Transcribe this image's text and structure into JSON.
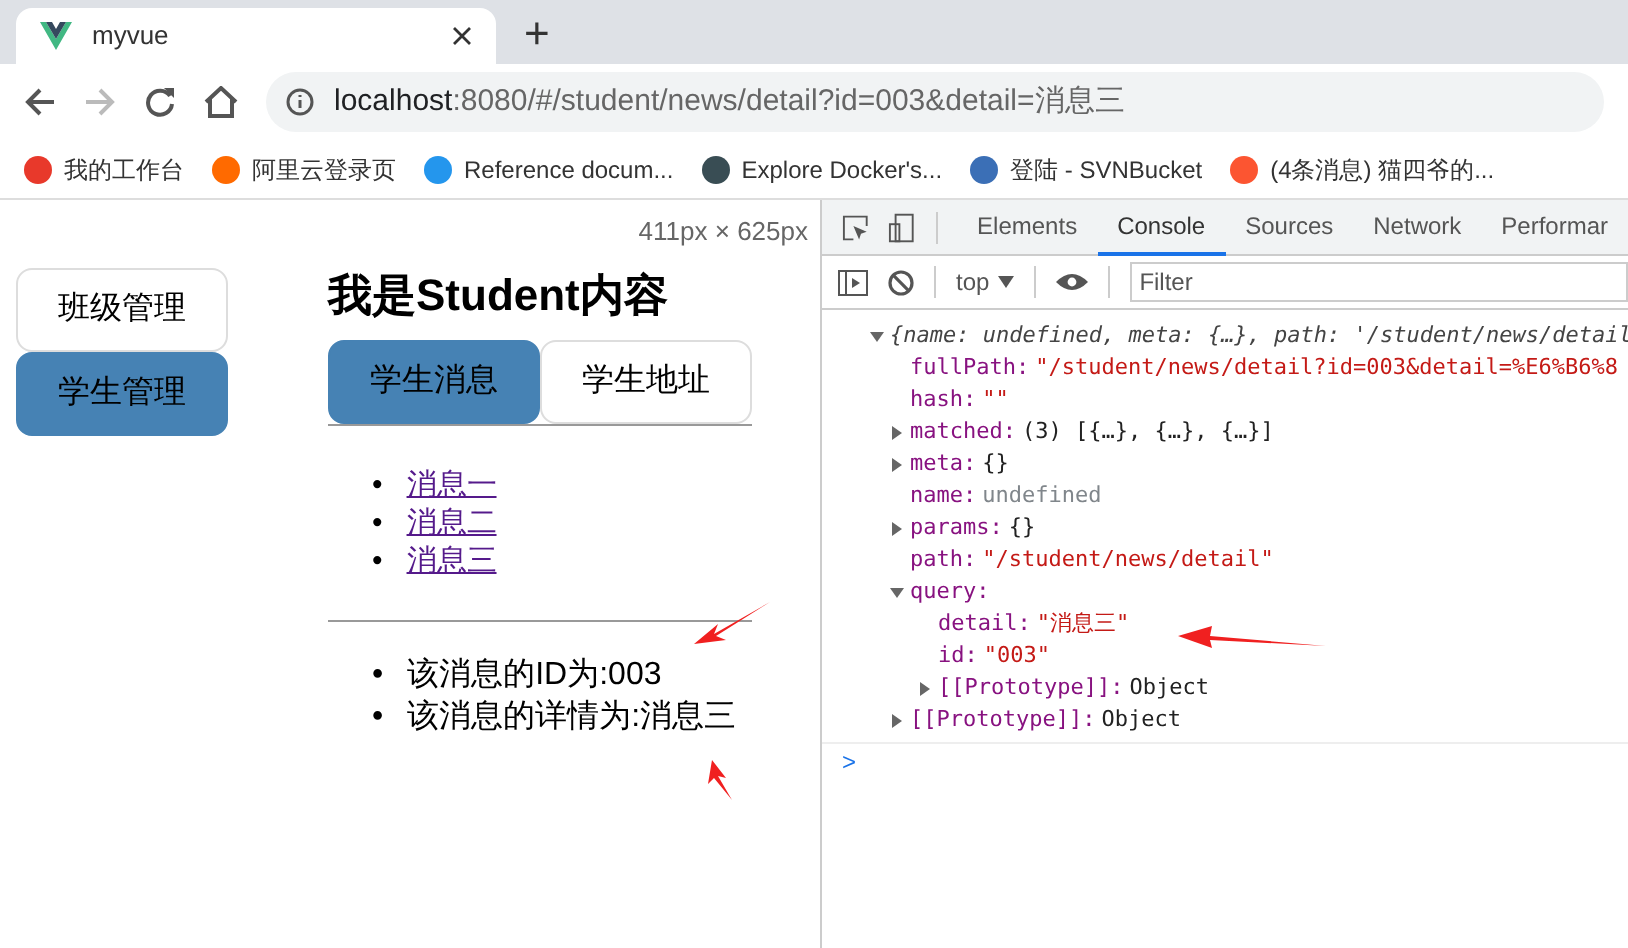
{
  "browser": {
    "tab": {
      "title": "myvue",
      "selected": true
    },
    "new_tab": "+",
    "address": {
      "host": "localhost",
      "rest": ":8080/#/student/news/detail?id=003&detail=消息三"
    },
    "bookmarks": [
      {
        "label": "我的工作台",
        "color": "#e8392b"
      },
      {
        "label": "阿里云登录页",
        "color": "#ff6a00"
      },
      {
        "label": "Reference docum...",
        "color": "#2496ed"
      },
      {
        "label": "Explore Docker's...",
        "color": "#394d54"
      },
      {
        "label": "登陆 - SVNBucket",
        "color": "#3b6fb6"
      },
      {
        "label": "(4条消息) 猫四爷的...",
        "color": "#fc5531"
      }
    ]
  },
  "page": {
    "size_hint": "411px × 625px",
    "sidebar": [
      {
        "label": "班级管理",
        "selected": false
      },
      {
        "label": "学生管理",
        "selected": true
      }
    ],
    "heading": "我是Student内容",
    "tabs": [
      {
        "label": "学生消息",
        "selected": true
      },
      {
        "label": "学生地址",
        "selected": false
      }
    ],
    "links": [
      {
        "marker": "•",
        "text": "消息一"
      },
      {
        "marker": "•",
        "text": "消息二"
      },
      {
        "marker": "•",
        "text": "消息三"
      }
    ],
    "details": [
      {
        "marker": "•",
        "text": "该消息的ID为:003"
      },
      {
        "marker": "•",
        "text": "该消息的详情为:消息三"
      }
    ]
  },
  "devtools": {
    "tabs": [
      {
        "label": "Elements",
        "selected": false
      },
      {
        "label": "Console",
        "selected": true
      },
      {
        "label": "Sources",
        "selected": false
      },
      {
        "label": "Network",
        "selected": false
      },
      {
        "label": "Performar",
        "selected": false
      }
    ],
    "context": "top",
    "filter_placeholder": "Filter",
    "log": {
      "summary": "{name: undefined, meta: {…}, path: '/student/news/detail",
      "expanded": true,
      "children": [
        {
          "key": "fullPath:",
          "value": "\"/student/news/detail?id=003&detail=%E6%B6%8",
          "kind": "string"
        },
        {
          "key": "hash:",
          "value": "\"\"",
          "kind": "string"
        },
        {
          "key": "matched:",
          "value": "(3) [{…}, {…}, {…}]",
          "kind": "plain",
          "expanded": false
        },
        {
          "key": "meta:",
          "value": "{}",
          "kind": "plain",
          "expanded": false
        },
        {
          "key": "name:",
          "value": "undefined",
          "kind": "undefined"
        },
        {
          "key": "params:",
          "value": "{}",
          "kind": "plain",
          "expanded": false
        },
        {
          "key": "path:",
          "value": "\"/student/news/detail\"",
          "kind": "string"
        },
        {
          "key": "query:",
          "expanded": true,
          "children": [
            {
              "key": "detail:",
              "value": "\"消息三\"",
              "kind": "string"
            },
            {
              "key": "id:",
              "value": "\"003\"",
              "kind": "string"
            },
            {
              "key": "[[Prototype]]:",
              "value": "Object",
              "kind": "plain",
              "expanded": false
            }
          ]
        },
        {
          "key": "[[Prototype]]:",
          "value": "Object",
          "kind": "plain",
          "expanded": false
        }
      ]
    },
    "prompt": ">"
  }
}
